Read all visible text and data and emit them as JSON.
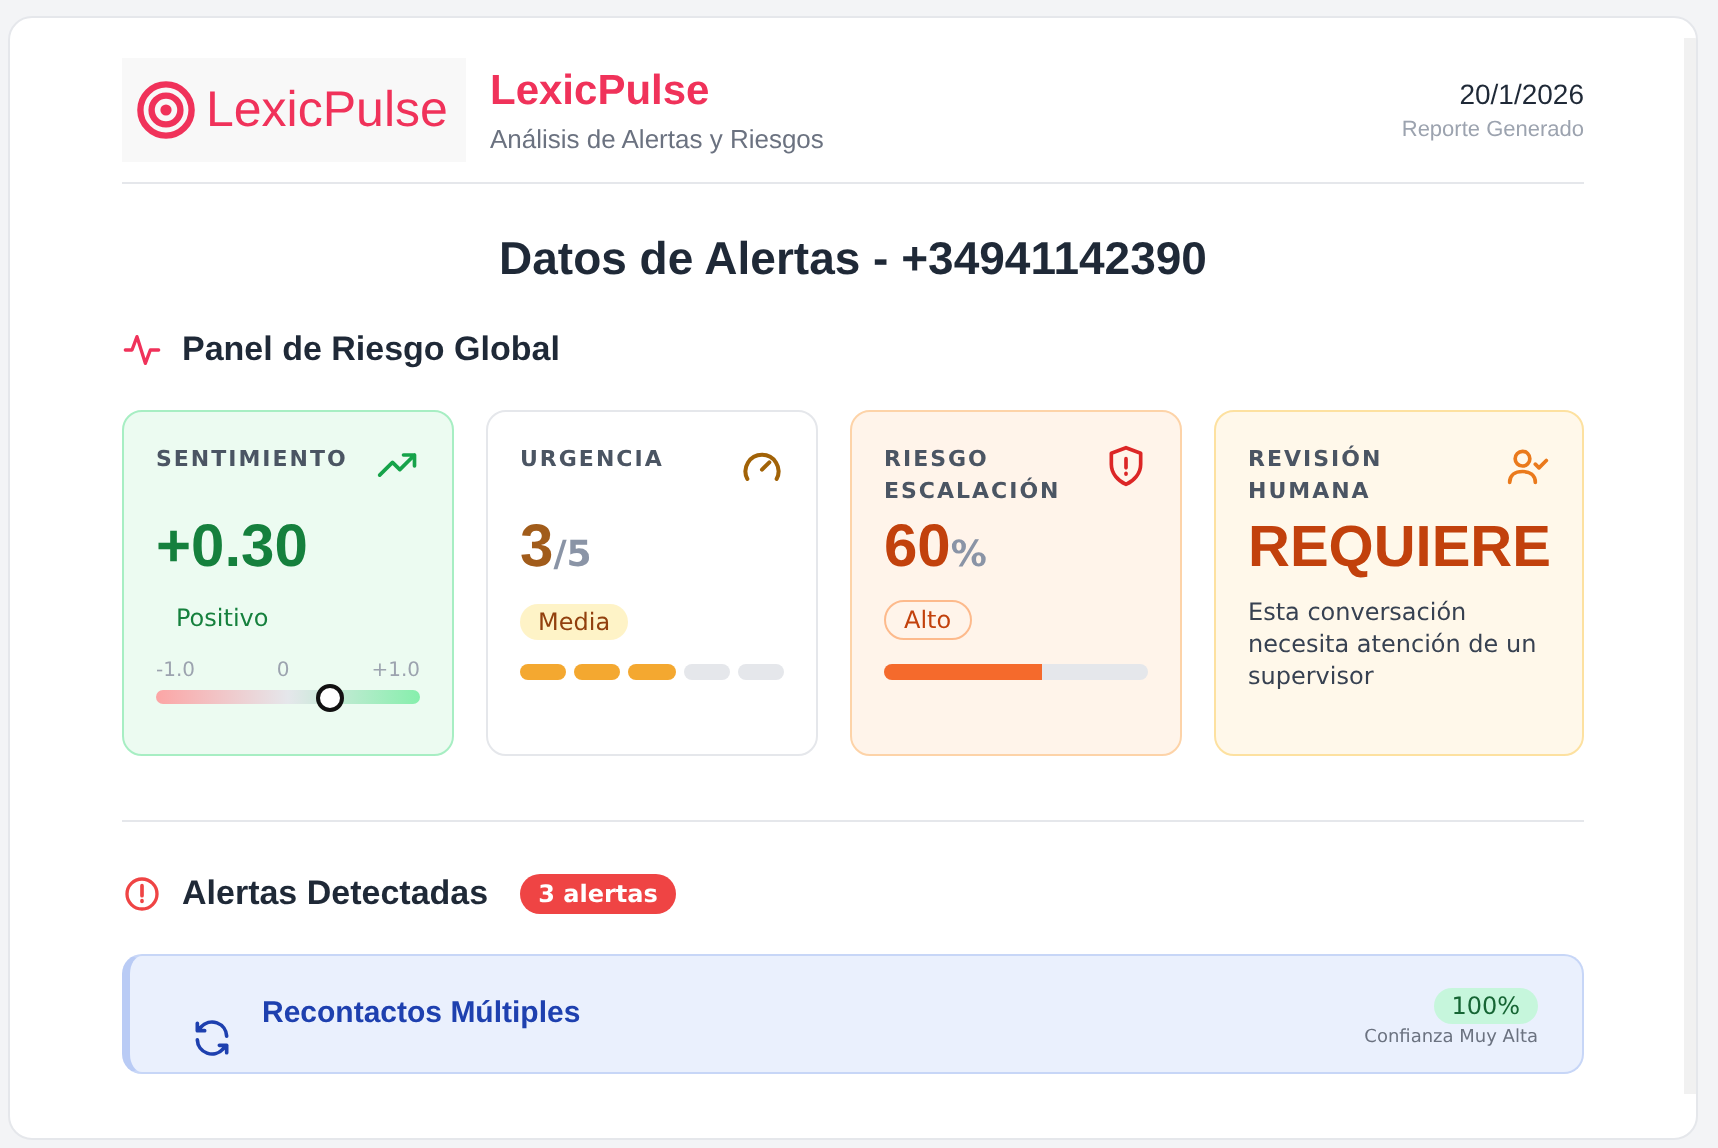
{
  "header": {
    "logo_text": "LexicPulse",
    "brand": "LexicPulse",
    "subtitle": "Análisis de Alertas y Riesgos",
    "date": "20/1/2026",
    "date_label": "Reporte Generado"
  },
  "title": "Datos de Alertas - +34941142390",
  "risk_panel": {
    "heading": "Panel de Riesgo Global",
    "cards": [
      {
        "kind": "sentiment",
        "label": "SENTIMIENTO",
        "value": "+0.30",
        "tag": "Positivo",
        "scale": [
          "-1.0",
          "0",
          "+1.0"
        ],
        "level": 0.65
      },
      {
        "kind": "urgency",
        "label": "URGENCIA",
        "value": "3",
        "unit": "/5",
        "tag": "Media",
        "level": 0.6
      },
      {
        "kind": "risk",
        "label": "RIESGO ESCALACIÓN",
        "value": "60",
        "unit": "%",
        "tag": "Alto",
        "level": 0.6
      },
      {
        "kind": "review",
        "label": "REVISIÓN HUMANA",
        "value": "REQUIERE",
        "note": "Esta conversación necesita atención de un supervisor"
      }
    ]
  },
  "alerts": {
    "heading": "Alertas Detectadas",
    "count": "3 alertas",
    "items": [
      {
        "title": "Recontactos Múltiples",
        "confidence": "100%",
        "confidence_label": "Confianza Muy Alta"
      }
    ]
  }
}
